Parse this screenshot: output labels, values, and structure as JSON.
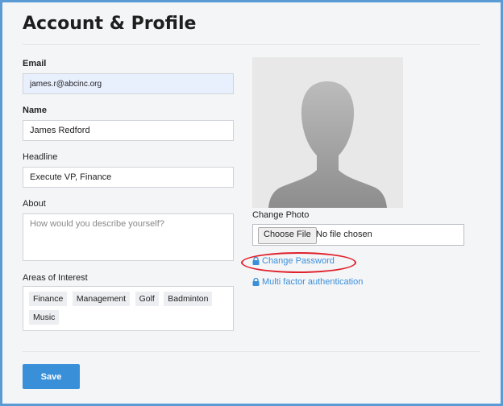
{
  "page": {
    "title": "Account & Profile"
  },
  "form": {
    "email": {
      "label": "Email",
      "value": "james.r@abcinc.org"
    },
    "name": {
      "label": "Name",
      "value": "James Redford"
    },
    "headline": {
      "label": "Headline",
      "value": "Execute VP, Finance"
    },
    "about": {
      "label": "About",
      "placeholder": "How would you describe yourself?"
    },
    "interests": {
      "label": "Areas of Interest",
      "tags": [
        "Finance",
        "Management",
        "Golf",
        "Badminton",
        "Music"
      ]
    }
  },
  "photo": {
    "label": "Change Photo",
    "choose_label": "Choose File",
    "file_status": "No file chosen"
  },
  "links": {
    "change_password": "Change Password",
    "mfa": "Multi factor authentication"
  },
  "actions": {
    "save_label": "Save"
  },
  "colors": {
    "accent": "#3a8fd9",
    "highlight_circle": "#e0202a",
    "frame_border": "#5b9bd5"
  },
  "icons": {
    "link_icon": "lock-icon"
  }
}
